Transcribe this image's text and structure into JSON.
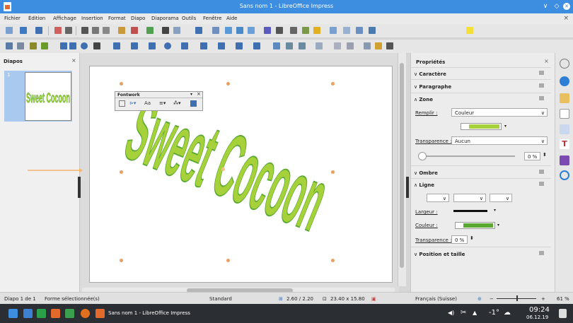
{
  "window": {
    "title": "Sans nom 1 - LibreOffice Impress",
    "btn_min": "∨",
    "btn_max": "◇",
    "btn_close": "✕"
  },
  "menu": {
    "items": [
      "Fichier",
      "Édition",
      "Affichage",
      "Insertion",
      "Format",
      "Diapo",
      "Diaporama",
      "Outils",
      "Fenêtre",
      "Aide"
    ],
    "close_doc": "×"
  },
  "slides_pane": {
    "title": "Diapos",
    "close": "×",
    "slide_number": "1"
  },
  "slide": {
    "fontwork_text": "Sweet Cocoon"
  },
  "fontwork_toolbar": {
    "title": "Fontwork",
    "close": "×",
    "text_button": "Aa"
  },
  "sidebar": {
    "title": "Propriétés",
    "close": "×",
    "sections": {
      "caractere": "Caractère",
      "paragraphe": "Paragraphe",
      "zone": "Zone",
      "ombre": "Ombre",
      "ligne": "Ligne",
      "position": "Position et taille"
    },
    "zone": {
      "remplir_label": "Remplir :",
      "remplir_value": "Couleur",
      "fill_color": "#a6d13b",
      "transparence_label": "Transparence :",
      "transparence_value": "Aucun",
      "transparence_percent": "0 %"
    },
    "ligne": {
      "largeur_label": "Largeur :",
      "couleur_label": "Couleur :",
      "line_color": "#5aa832",
      "transparence_label": "Transparence :",
      "transparence_value": "0 %"
    }
  },
  "status": {
    "slide": "Diapo 1 de 1",
    "selection": "Forme sélectionnée(s)",
    "layout": "Standard",
    "position": "2.60 / 2.20",
    "size": "23.40 x 15.80",
    "language": "Français (Suisse)",
    "zoom_minus": "−",
    "zoom_plus": "+",
    "zoom": "61 %"
  },
  "taskbar": {
    "task_title": "Sans nom 1 - LibreOffice Impress",
    "temperature": "-1°",
    "time": "09:24",
    "date": "06.12.19"
  },
  "colors": {
    "accent": "#3d8ee0",
    "handle": "#e8a060",
    "arrow": "#f5b26b"
  }
}
